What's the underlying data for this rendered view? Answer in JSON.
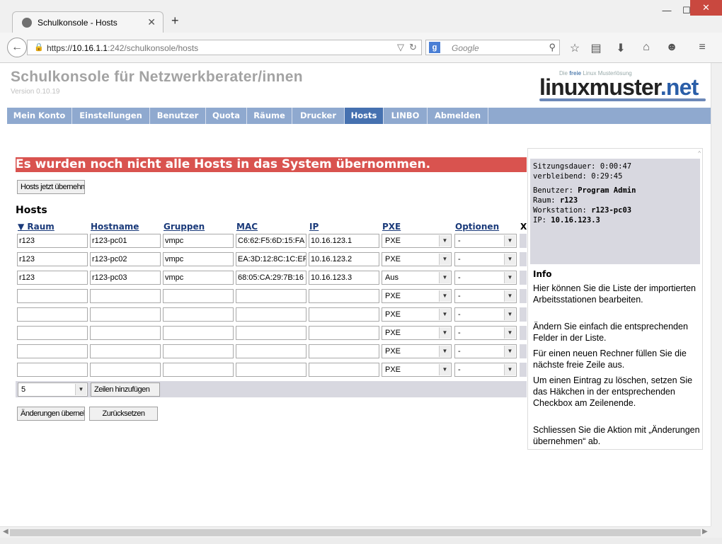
{
  "browser": {
    "tab_title": "Schulkonsole - Hosts",
    "url_prefix": "https://",
    "url_host": "10.16.1.1",
    "url_rest": ":242/schulkonsole/hosts",
    "search_engine": "Google",
    "window_buttons": {
      "minimize": "—",
      "maximize": "☐",
      "close": "✕"
    }
  },
  "header": {
    "title": "Schulkonsole für Netzwerkberater/innen",
    "version": "Version 0.10.19",
    "logo_small_pre": "Die ",
    "logo_small_freie": "freie",
    "logo_small_post": " Linux Musterlösung",
    "logo_main": "linuxmuster",
    "logo_dot": ".",
    "logo_net": "net"
  },
  "menu": [
    {
      "label": "Mein Konto",
      "active": false
    },
    {
      "label": "Einstellungen",
      "active": false
    },
    {
      "label": "Benutzer",
      "active": false
    },
    {
      "label": "Quota",
      "active": false
    },
    {
      "label": "Räume",
      "active": false
    },
    {
      "label": "Drucker",
      "active": false
    },
    {
      "label": "Hosts",
      "active": true
    },
    {
      "label": "LINBO",
      "active": false
    },
    {
      "label": "Abmelden",
      "active": false
    }
  ],
  "alert": "Es wurden noch nicht alle Hosts in das System übernommen.",
  "import_button": "Hosts jetzt übernehmen",
  "section_title": "Hosts",
  "table": {
    "headers": {
      "raum": "▼ Raum",
      "hostname": "Hostname",
      "gruppen": "Gruppen",
      "mac": "MAC",
      "ip": "IP",
      "pxe": "PXE",
      "optionen": "Optionen",
      "x": "X"
    },
    "rows": [
      {
        "raum": "r123",
        "hostname": "r123-pc01",
        "gruppen": "vmpc",
        "mac": "C6:62:F5:6D:15:FA",
        "ip": "10.16.123.1",
        "pxe": "PXE",
        "optionen": "-"
      },
      {
        "raum": "r123",
        "hostname": "r123-pc02",
        "gruppen": "vmpc",
        "mac": "EA:3D:12:8C:1C:EF",
        "ip": "10.16.123.2",
        "pxe": "PXE",
        "optionen": "-"
      },
      {
        "raum": "r123",
        "hostname": "r123-pc03",
        "gruppen": "vmpc",
        "mac": "68:05:CA:29:7B:16",
        "ip": "10.16.123.3",
        "pxe": "Aus",
        "optionen": "-"
      },
      {
        "raum": "",
        "hostname": "",
        "gruppen": "",
        "mac": "",
        "ip": "",
        "pxe": "PXE",
        "optionen": "-"
      },
      {
        "raum": "",
        "hostname": "",
        "gruppen": "",
        "mac": "",
        "ip": "",
        "pxe": "PXE",
        "optionen": "-"
      },
      {
        "raum": "",
        "hostname": "",
        "gruppen": "",
        "mac": "",
        "ip": "",
        "pxe": "PXE",
        "optionen": "-"
      },
      {
        "raum": "",
        "hostname": "",
        "gruppen": "",
        "mac": "",
        "ip": "",
        "pxe": "PXE",
        "optionen": "-"
      },
      {
        "raum": "",
        "hostname": "",
        "gruppen": "",
        "mac": "",
        "ip": "",
        "pxe": "PXE",
        "optionen": "-"
      }
    ],
    "add_count": "5",
    "add_rows_button": "Zeilen hinzufügen"
  },
  "actions": {
    "apply": "Änderungen übernehmen",
    "reset": "Zurücksetzen"
  },
  "session": {
    "duration_label": "Sitzungsdauer:",
    "duration_value": "0:00:47",
    "remaining_label": "verbleibend:",
    "remaining_value": "0:29:45",
    "user_label": "Benutzer:",
    "user_value": "Program Admin",
    "room_label": "Raum:",
    "room_value": "r123",
    "workstation_label": "Workstation:",
    "workstation_value": "r123-pc03",
    "ip_label": "IP:",
    "ip_value": "10.16.123.3"
  },
  "info": {
    "title": "Info",
    "paragraphs": [
      "Hier können Sie die Liste der importierten Arbeitsstationen bearbeiten.",
      "Ändern Sie einfach die entsprechenden Felder in der Liste.",
      "Für einen neuen Rechner füllen Sie die nächste freie Zeile aus.",
      "Um einen Eintrag zu löschen, setzen Sie das Häkchen in der entsprechenden Checkbox am Zeilenende.",
      "Schliessen Sie die Aktion mit „Änderungen übernehmen“ ab."
    ]
  },
  "colors": {
    "accent": "#4671b0",
    "menubar": "#8fa9cf",
    "alert": "#d9534f",
    "row_shade": "#d8d8e0"
  },
  "icons": {
    "back": "back-arrow-icon",
    "lock": "lock-icon",
    "reload": "reload-icon",
    "search": "search-icon",
    "bookmark": "star-icon",
    "reader": "reading-list-icon",
    "download": "download-icon",
    "home": "home-icon",
    "chat": "chat-icon",
    "menu": "hamburger-menu-icon"
  }
}
